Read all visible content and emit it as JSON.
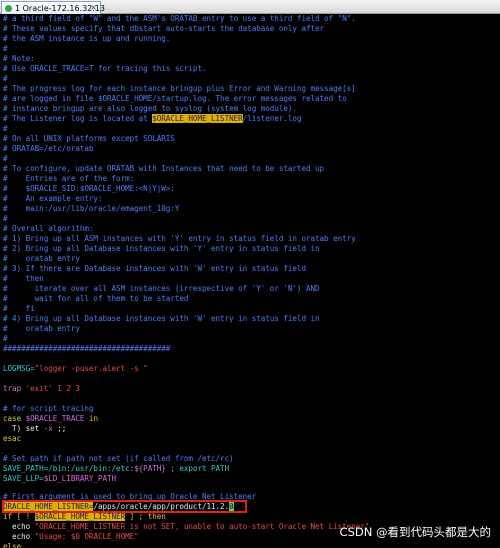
{
  "window": {
    "tab_label": "1 Oracle-172.16.32.13",
    "tab_close": "×",
    "status_icon": "green-dot-icon"
  },
  "script": {
    "l01": "# a third field of \"W\" and the ASM's ORATAB entry to use a third field of \"N\".",
    "l02": "# These values specify that dbstart auto-starts the database only after",
    "l03": "# the ASM instance is up and running.",
    "l04": "#",
    "l05": "# Note:",
    "l06": "# Use ORACLE_TRACE=T for tracing this script.",
    "l07": "#",
    "l08": "# The progress log for each instance bringup plus Error and Warning message[s]",
    "l09": "# are logged in file $ORACLE_HOME/startup.log. The error messages related to",
    "l10": "# instance bringup are also logged to syslog (system log module).",
    "l11a": "# The Listener log is located at ",
    "l11b": "$ORACLE_HOME_LISTNER",
    "l11c": "/listener.log",
    "l12": "#",
    "l13": "# On all UNIX platforms except SOLARIS",
    "l14": "# ORATAB=/etc/oratab",
    "l15": "#",
    "l16": "# To configure, update ORATAB with Instances that need to be started up",
    "l17": "#    Entries are of the form:",
    "l18": "#    $ORACLE_SID:$ORACLE_HOME:<N|Y|W>:",
    "l19": "#    An example entry:",
    "l20": "#    main:/usr/lib/oracle/emagent_10g:Y",
    "l21": "#",
    "l22": "# Overall algorithm:",
    "l23": "# 1) Bring up all ASM instances with 'Y' entry in status field in oratab entry",
    "l24": "# 2) Bring up all Database instances with 'Y' entry in status field in",
    "l25": "#    oratab entry",
    "l26": "# 3) If there are Database instances with 'W' entry in status field",
    "l27": "#    then",
    "l28": "#      iterate over all ASM instances (irrespective of 'Y' or 'N') AND",
    "l29": "#      wait for all of them to be started",
    "l30": "#    fi",
    "l31": "# 4) Bring up all Database instances with 'W' entry in status field in",
    "l32": "#    oratab entry",
    "l33": "#",
    "l34": "#####################################",
    "l35": "",
    "l36a": "LOGMSG=",
    "l36b": "\"logger -puser.alert -s \"",
    "l37": "",
    "l38a": "trap ",
    "l38b": "'exit'",
    "l38c": " 1 2 3",
    "l39": "",
    "l40": "# for script tracing",
    "l41a": "case ",
    "l41b": "$ORACLE_TRACE",
    "l41c": " in",
    "l42a": "  T) set ",
    "l42b": "-x",
    "l42c": " ;;",
    "l43": "esac",
    "l44": "",
    "l45": "# Set path if path not set (if called from /etc/rc)",
    "l46a": "SAVE_PATH=/bin:/usr/bin:/etc:",
    "l46b": "${PATH}",
    "l46c": " ; export PATH",
    "l47a": "SAVE_LLP=",
    "l47b": "$LD_LIBRARY_PATH",
    "l48": "",
    "l49": "# First argument is used to bring up Oracle Net Listener",
    "l50a": "ORACLE_HOME_LISTNER=",
    "l50b": "/apps/oracle/app/product/11.2.",
    "l50c": "0",
    "l51a": "if [ ! ",
    "l51b": "$ORACLE_HOME_LISTNER",
    "l51c": " ] ; then",
    "l52a": "  echo ",
    "l52b": "\"ORACLE_HOME_LISTNER is not SET, unable to auto-start Oracle Net Listener\"",
    "l53a": "  echo ",
    "l53b": "\"Usage: $0 ORACLE_HOME\"",
    "l54": "else"
  },
  "watermark": "CSDN @看到代码头都是大的",
  "colors": {
    "comment": "#4d7cf6",
    "text": "#e8e8e8",
    "variable": "#39c8c8",
    "string": "#e84a4a",
    "keyword": "#d66ad6",
    "search_highlight": "#e0b000",
    "annotation_box": "#e0201a"
  }
}
